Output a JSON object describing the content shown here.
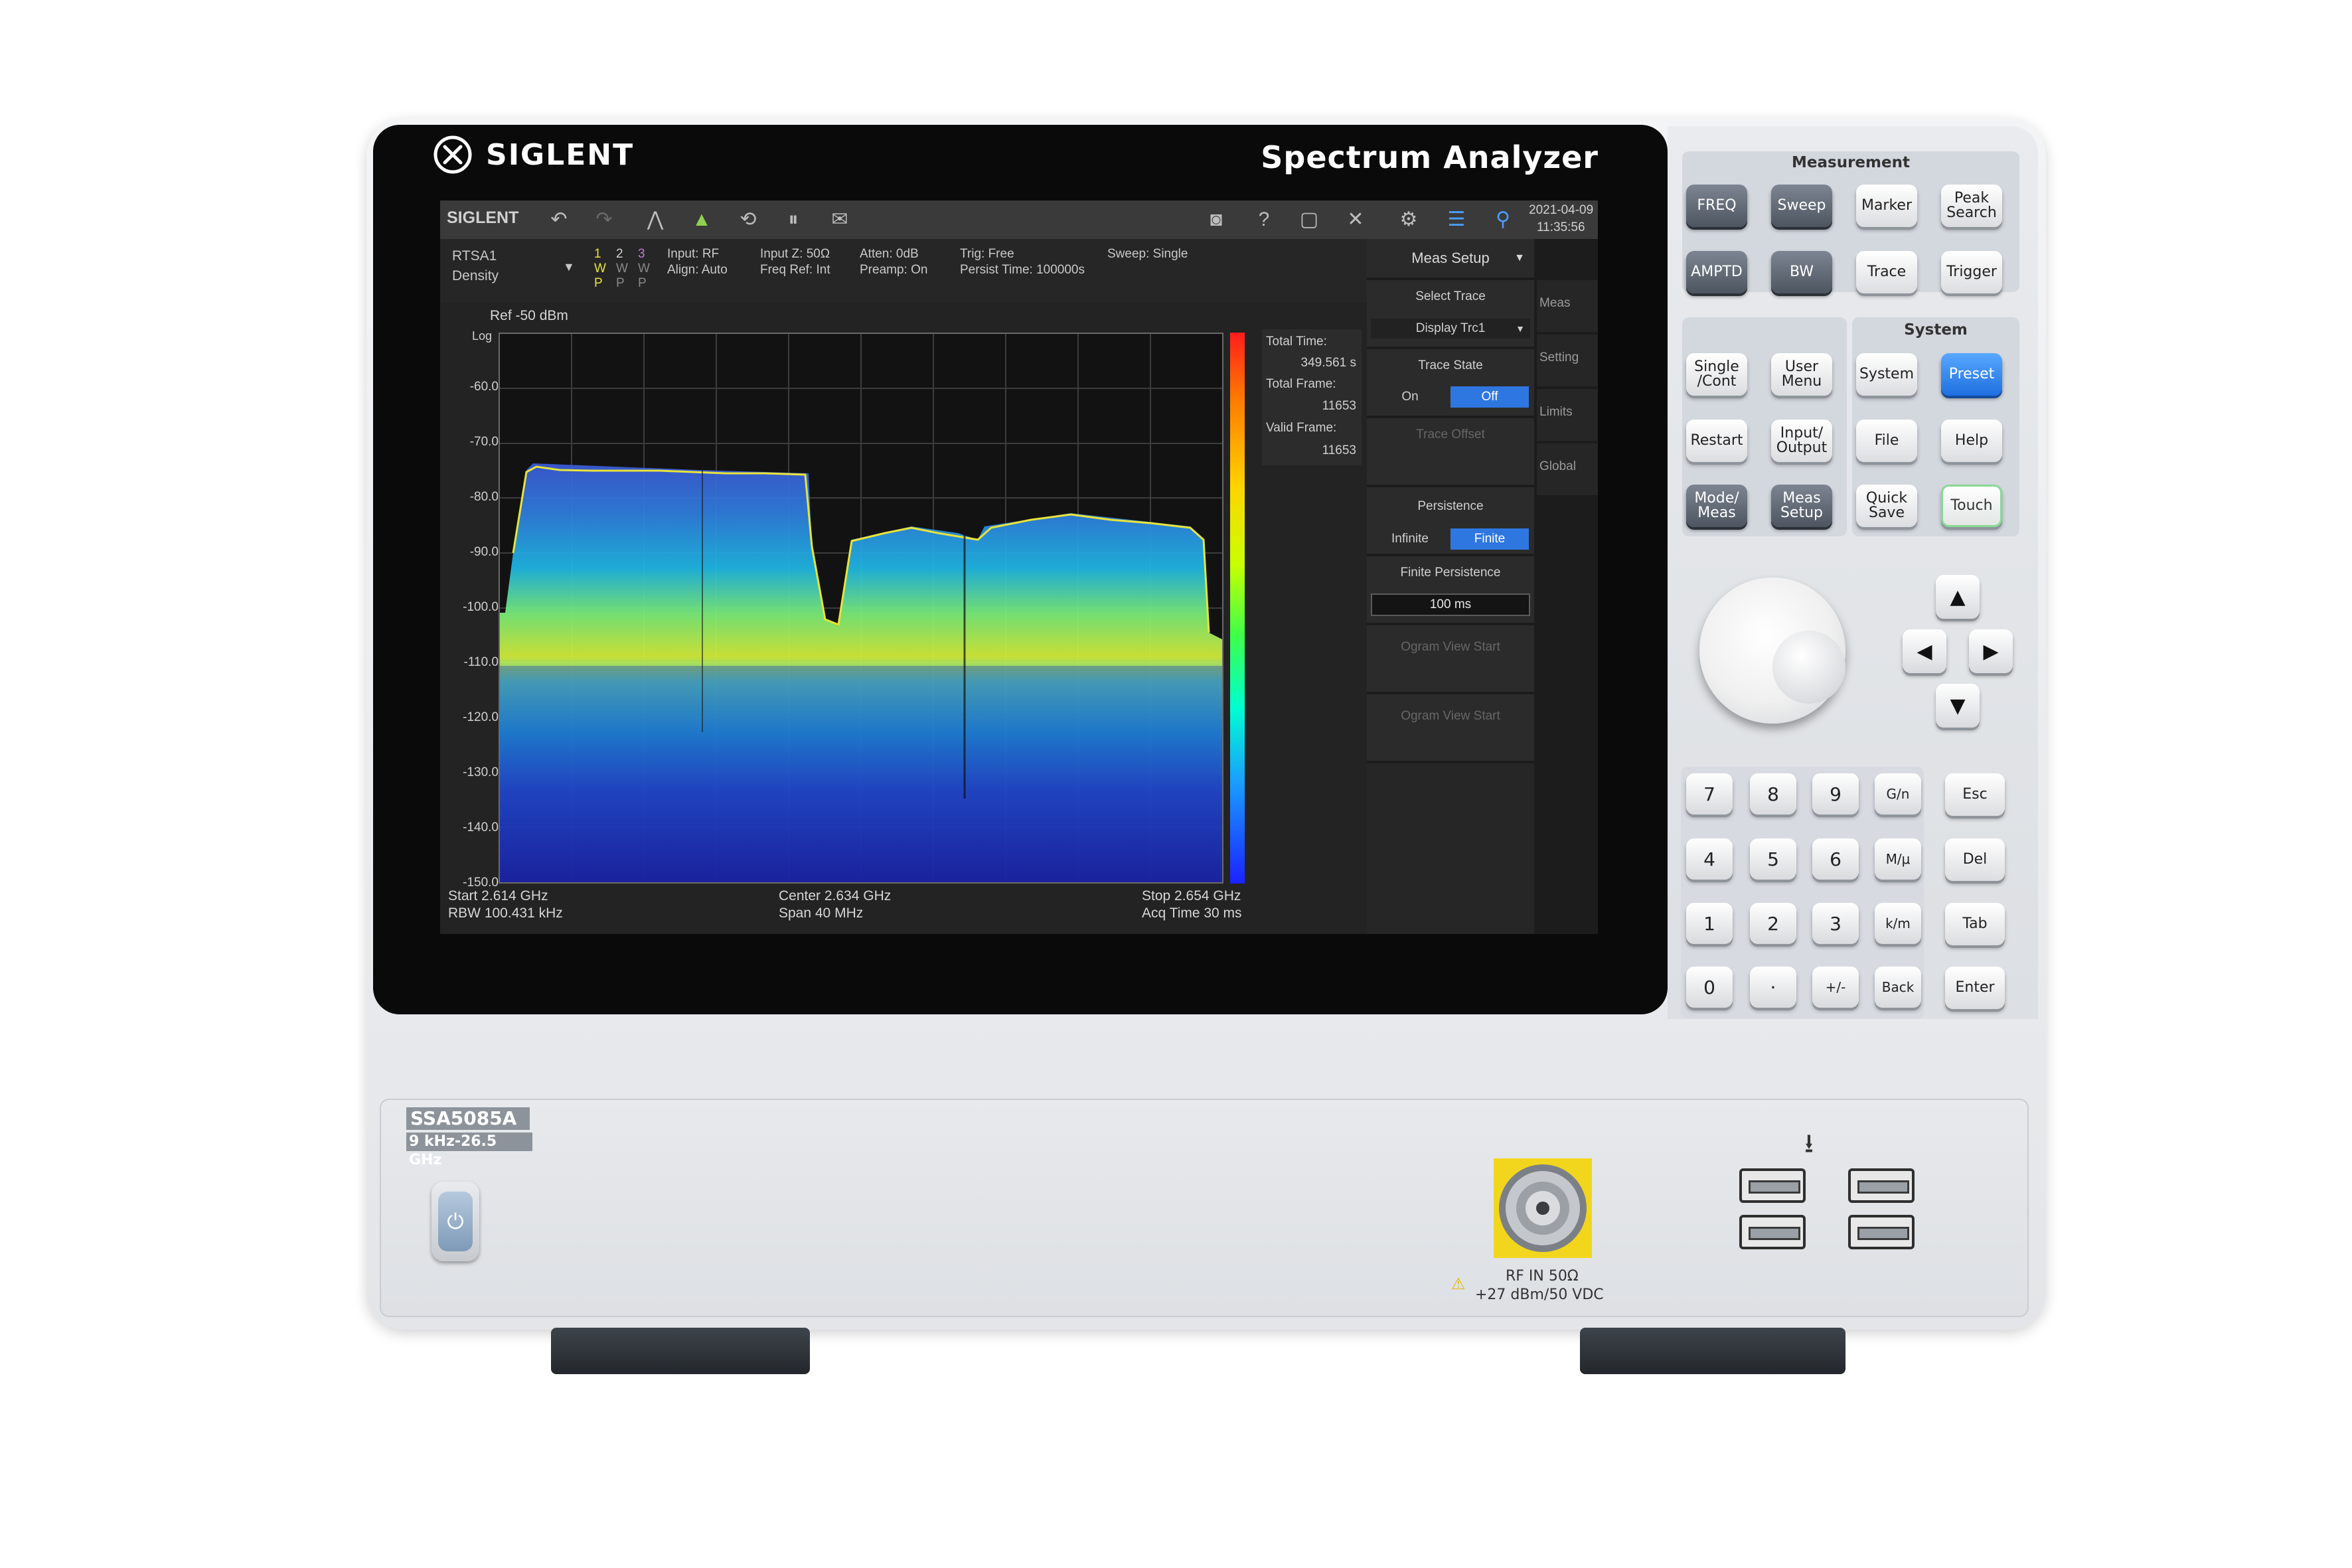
{
  "device": {
    "brand": "SIGLENT",
    "product_title": "Spectrum Analyzer",
    "model": "SSA5085A",
    "freq_range": "9 kHz-26.5 GHz",
    "rf_in_label": "RF IN 50Ω",
    "rf_in_limit": "+27 dBm/50 VDC"
  },
  "screen": {
    "topbar": {
      "brand": "SIGLENT",
      "date": "2021-04-09",
      "time": "11:35:56"
    },
    "mode": {
      "name": "RTSA1",
      "view": "Density"
    },
    "trace_indicators": [
      {
        "num": "1",
        "a": "W",
        "b": "P",
        "color": "#e8e33a"
      },
      {
        "num": "2",
        "a": "W",
        "b": "P",
        "color": "#d0d0d0"
      },
      {
        "num": "3",
        "a": "W",
        "b": "P",
        "color": "#c07ad8"
      }
    ],
    "info": {
      "input": "Input: RF",
      "align": "Align: Auto",
      "input_z": "Input Z: 50Ω",
      "freq_ref": "Freq Ref: Int",
      "atten": "Atten: 0dB",
      "preamp": "Preamp: On",
      "trig": "Trig: Free",
      "persist_time": "Persist Time: 100000s",
      "sweep": "Sweep: Single"
    },
    "plot": {
      "ref": "Ref  -50 dBm",
      "scale": "Log",
      "y_ticks": [
        "-60.0",
        "-70.0",
        "-80.0",
        "-90.0",
        "-100.0",
        "-110.0",
        "-120.0",
        "-130.0",
        "-140.0",
        "-150.0"
      ],
      "stats": {
        "total_time_label": "Total Time:",
        "total_time": "349.561 s",
        "total_frame_label": "Total Frame:",
        "total_frame": "11653",
        "valid_frame_label": "Valid Frame:",
        "valid_frame": "11653"
      },
      "start": "Start  2.614 GHz",
      "rbw": "RBW  100.431 kHz",
      "center": "Center  2.634 GHz",
      "span": "Span  40 MHz",
      "stop": "Stop  2.654 GHz",
      "acq_time": "Acq Time  30 ms"
    },
    "menu": {
      "header": "Meas Setup",
      "select_trace_label": "Select Trace",
      "select_trace_value": "Display Trc1",
      "trace_state_label": "Trace State",
      "trace_state_on": "On",
      "trace_state_off": "Off",
      "trace_offset": "Trace Offset",
      "persistence_label": "Persistence",
      "persistence_infinite": "Infinite",
      "persistence_finite": "Finite",
      "finite_persistence_label": "Finite Persistence",
      "finite_persistence_value": "100 ms",
      "ogram_view_start_1": "Ogram View Start",
      "ogram_view_start_2": "Ogram View Start",
      "tabs": [
        "Meas",
        "Setting",
        "Limits",
        "Global"
      ]
    }
  },
  "keypad": {
    "measurement_title": "Measurement",
    "system_title": "System",
    "meas_keys": [
      {
        "label": "FREQ",
        "style": "dark"
      },
      {
        "label": "Sweep",
        "style": "dark"
      },
      {
        "label": "Marker",
        "style": "light"
      },
      {
        "label": "Peak Search",
        "style": "light"
      },
      {
        "label": "AMPTD",
        "style": "dark"
      },
      {
        "label": "BW",
        "style": "dark"
      },
      {
        "label": "Trace",
        "style": "light"
      },
      {
        "label": "Trigger",
        "style": "light"
      }
    ],
    "sys_keys": [
      {
        "label": "Single /Cont",
        "style": "light"
      },
      {
        "label": "User Menu",
        "style": "light"
      },
      {
        "label": "System",
        "style": "light"
      },
      {
        "label": "Preset",
        "style": "blue"
      },
      {
        "label": "Restart",
        "style": "light"
      },
      {
        "label": "Input/ Output",
        "style": "light"
      },
      {
        "label": "File",
        "style": "light"
      },
      {
        "label": "Help",
        "style": "light"
      },
      {
        "label": "Mode/ Meas",
        "style": "dark"
      },
      {
        "label": "Meas Setup",
        "style": "dark"
      },
      {
        "label": "Quick Save",
        "style": "light"
      },
      {
        "label": "Touch",
        "style": "green"
      }
    ],
    "numpad": [
      "7",
      "8",
      "9",
      "G/n",
      "4",
      "5",
      "6",
      "M/μ",
      "1",
      "2",
      "3",
      "k/m",
      "0",
      "·",
      "+/-",
      "Back"
    ],
    "side_keys": [
      "Esc",
      "Del",
      "Tab",
      "Enter"
    ]
  },
  "colors": {
    "accent_blue": "#2f77e0",
    "screen_bg": "#2a2a2a",
    "trace_yellow": "#e8e33a"
  }
}
